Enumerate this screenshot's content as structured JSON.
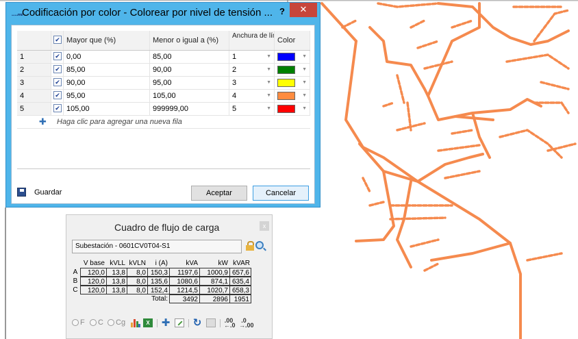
{
  "dialog": {
    "title": "Codificación por color - Colorear por nivel de tensión ...",
    "app_icon": "app-logo-icon",
    "help_label": "?",
    "close_label": "✕",
    "columns": [
      "Mayor que (%)",
      "Menor o igual a (%)",
      "Anchura de línea",
      "Color"
    ],
    "rows": [
      {
        "num": "1",
        "checked": true,
        "greater": "0,00",
        "less_eq": "85,00",
        "width": "1",
        "color": "#0000ff"
      },
      {
        "num": "2",
        "checked": true,
        "greater": "85,00",
        "less_eq": "90,00",
        "width": "2",
        "color": "#008000"
      },
      {
        "num": "3",
        "checked": true,
        "greater": "90,00",
        "less_eq": "95,00",
        "width": "3",
        "color": "#ffff00"
      },
      {
        "num": "4",
        "checked": true,
        "greater": "95,00",
        "less_eq": "105,00",
        "width": "4",
        "color": "#ff8c40"
      },
      {
        "num": "5",
        "checked": true,
        "greater": "105,00",
        "less_eq": "999999,00",
        "width": "5",
        "color": "#ff0000"
      }
    ],
    "add_row_text": "Haga clic para agregar una nueva fila",
    "save_label": "Guardar",
    "ok_label": "Aceptar",
    "cancel_label": "Cancelar"
  },
  "load_flow": {
    "title": "Cuadro de flujo de carga",
    "close_label": "x",
    "substation": "Subestación - 0601CV0T04-S1",
    "headers": [
      "",
      "V base",
      "kVLL",
      "kVLN",
      "i (A)",
      "kVA",
      "kW",
      "kVAR"
    ],
    "rows": [
      {
        "phase": "A",
        "vbase": "120,0",
        "kvll": "13,8",
        "kvln": "8,0",
        "i": "150,3",
        "kva": "1197,6",
        "kw": "1000,9",
        "kvar": "657,6"
      },
      {
        "phase": "B",
        "vbase": "120,0",
        "kvll": "13,8",
        "kvln": "8,0",
        "i": "135,6",
        "kva": "1080,6",
        "kw": "874,1",
        "kvar": "635,4"
      },
      {
        "phase": "C",
        "vbase": "120,0",
        "kvll": "13,8",
        "kvln": "8,0",
        "i": "152,4",
        "kva": "1214,5",
        "kw": "1020,7",
        "kvar": "658,3"
      }
    ],
    "total_label": "Total:",
    "total_kva": "3492",
    "total_kw": "2896",
    "total_kvar": "1951",
    "radio_labels": [
      "F",
      "C",
      "Cg"
    ]
  },
  "map": {
    "line_color": "#f58a4e"
  }
}
